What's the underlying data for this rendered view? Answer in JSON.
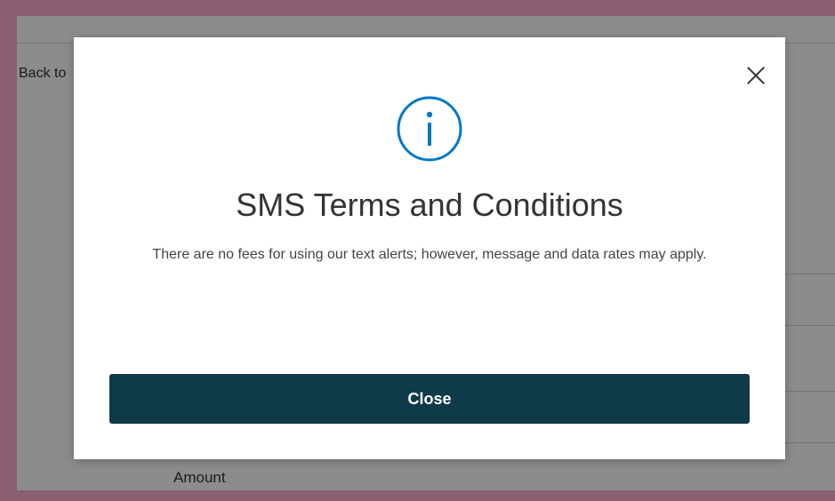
{
  "background_page": {
    "back_link_label": "Back to",
    "amount_label": "Amount"
  },
  "modal": {
    "title": "SMS Terms and Conditions",
    "body": "There are no fees for using our text alerts; however, message and data rates may apply.",
    "close_button_label": "Close",
    "icon": "info-icon",
    "close_icon": "close-icon"
  },
  "colors": {
    "accent": "#0078c8",
    "button": "#0f3a4a",
    "frame_border": "#8b5e73"
  }
}
